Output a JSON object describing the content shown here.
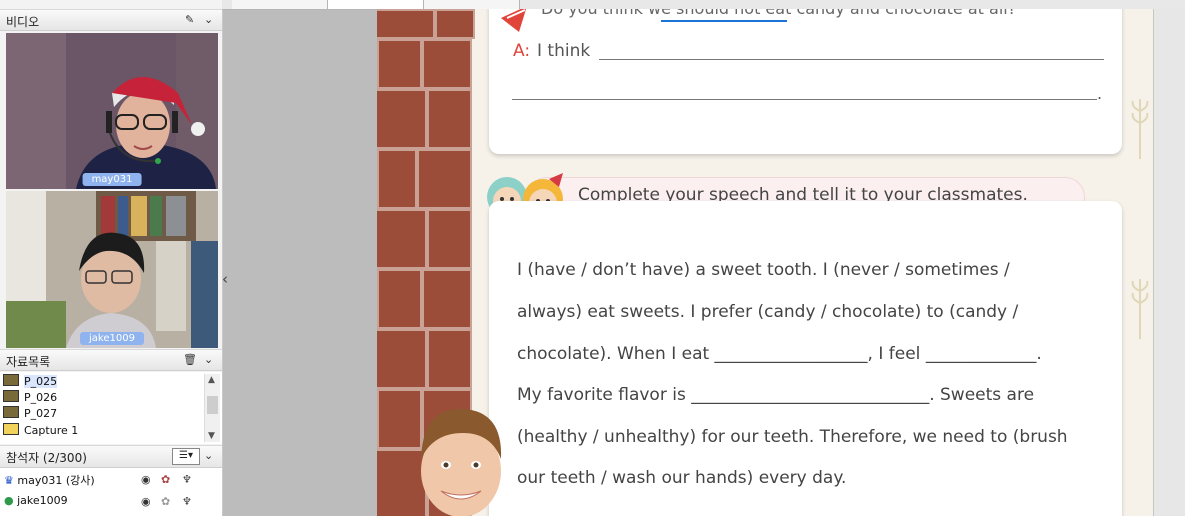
{
  "sidebar": {
    "video_title": "비디오",
    "videos": [
      {
        "label": "may031"
      },
      {
        "label": "jake1009"
      }
    ],
    "collapse_arrow": "‹",
    "files_title": "자료목록",
    "files": [
      "P_025",
      "P_026",
      "P_027",
      "Capture 1"
    ],
    "participants_title": "참석자 (2/300)",
    "participants": [
      {
        "name": "may031 (강사)"
      },
      {
        "name": "jake1009"
      }
    ]
  },
  "document": {
    "question": "Do you think we should not eat candy and chocolate at all?",
    "answer_prefix": "A:",
    "answer_start": "I think",
    "answer_end": ".",
    "section_title": "Complete your speech and tell it to your classmates.",
    "speech_lines": [
      "I (have / don’t have) a sweet tooth. I (never / sometimes /",
      "always) eat sweets. I prefer (candy / chocolate) to (candy /",
      "chocolate). When I eat __________________, I feel _____________.",
      "My favorite flavor is ____________________________. Sweets are",
      "(healthy / unhealthy) for our teeth. Therefore, we need to (brush",
      "our teeth / wash our hands) every day."
    ]
  },
  "colors": {
    "accent_red": "#e0443a",
    "label_blue": "#8fb3ee",
    "pen_blue": "#1a73d6"
  }
}
